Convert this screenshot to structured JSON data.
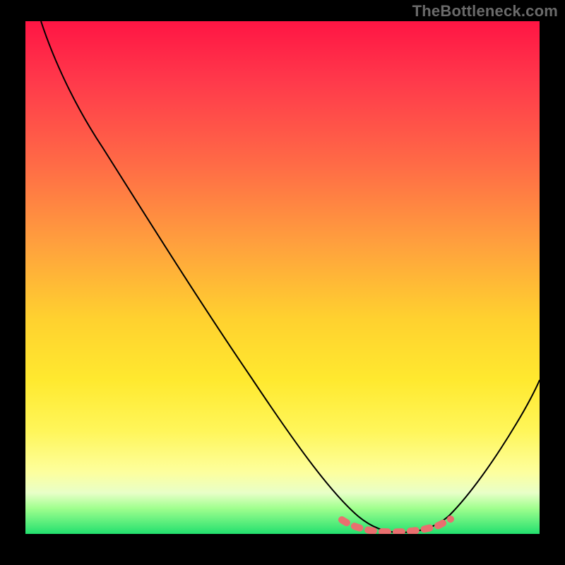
{
  "watermark": "TheBottleneck.com",
  "chart_data": {
    "type": "line",
    "title": "",
    "xlabel": "",
    "ylabel": "",
    "xlim": [
      0,
      100
    ],
    "ylim": [
      0,
      100
    ],
    "grid": false,
    "series": [
      {
        "name": "bottleneck-curve",
        "x": [
          3,
          8,
          15,
          22,
          30,
          38,
          46,
          54,
          60,
          64,
          68,
          72,
          76,
          80,
          84,
          88,
          94,
          100
        ],
        "y": [
          100,
          94,
          85,
          75,
          64,
          53,
          42,
          30,
          20,
          12,
          6,
          2,
          0,
          2,
          6,
          14,
          26,
          40
        ]
      }
    ],
    "annotations": [
      {
        "name": "valley-highlight",
        "type": "polyline",
        "color": "#e96f6f",
        "x": [
          62,
          66,
          70,
          74,
          78,
          82,
          84
        ],
        "y": [
          5,
          3,
          1,
          0,
          0,
          2,
          4
        ]
      }
    ]
  }
}
